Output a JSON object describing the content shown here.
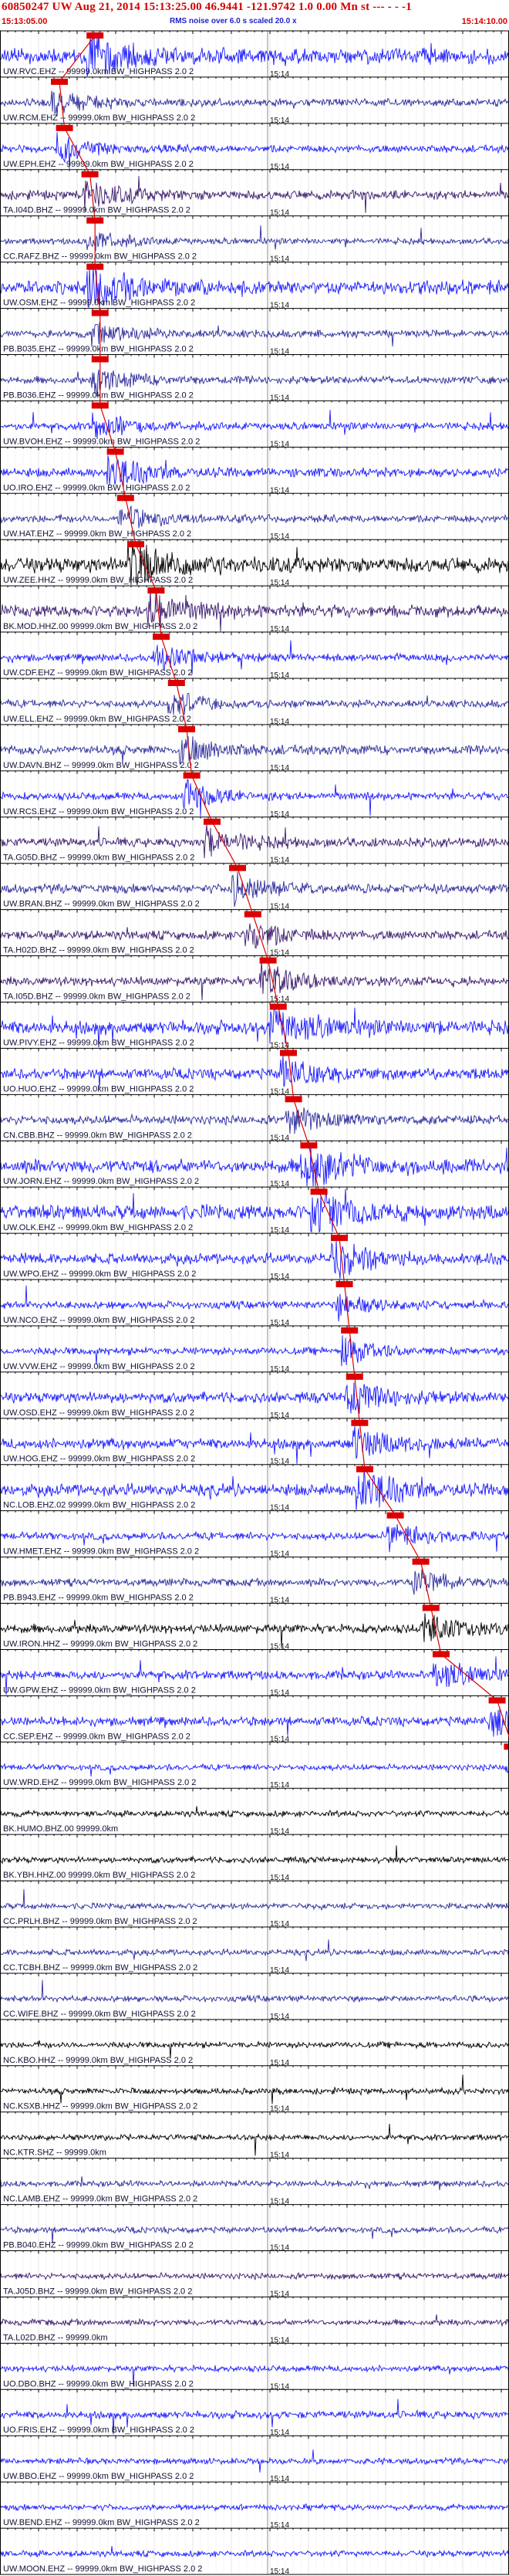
{
  "header": {
    "title": "60850247 UW Aug 21, 2014 15:13:25.00 46.9441 -121.9742 1.0 0.00 Mn st --- - - -1",
    "start_time": "15:13:05.00",
    "end_time": "15:14:10.00",
    "scale_note": "RMS noise over 6.0 s scaled 20.0 x"
  },
  "colors": {
    "trace_palette": [
      "#1a1aff",
      "#000000",
      "#2c2c9c",
      "#3b1a6e",
      "#111144"
    ],
    "pick": "#dd0000",
    "grid": "#000000"
  },
  "chart_data": {
    "type": "line",
    "title": "60850247 UW Aug 21, 2014 15:13:25.00 46.9441 -121.9742 1.0 0.00 Mn st --- - - -1",
    "x_start": "15:13:05.00",
    "x_end": "15:14:10.00",
    "time_tick_label": "15:14",
    "channels": [
      {
        "label": "UW.RVC.EHZ -- 99999.0km BW_HIGHPASS 2.0 2",
        "pick": 0.17,
        "color": "#1a1aff",
        "amp": 1.0
      },
      {
        "label": "UW.RCM.EHZ -- 99999.0km BW_HIGHPASS 2.0 2",
        "pick": 0.1,
        "color": "#2c2c9c",
        "amp": 0.5
      },
      {
        "label": "UW.EPH.EHZ -- 99999.0km BW_HIGHPASS 2.0 2",
        "pick": 0.11,
        "color": "#1a1aff",
        "amp": 0.5
      },
      {
        "label": "TA.I04D.BHZ -- 99999.0km BW_HIGHPASS 2.0 2",
        "pick": 0.16,
        "color": "#3b1a6e",
        "amp": 0.6
      },
      {
        "label": "CC.RAFZ.BHZ -- 99999.0km BW_HIGHPASS 2.0 2",
        "pick": 0.17,
        "color": "#2c2c9c",
        "amp": 0.4
      },
      {
        "label": "UW.OSM.EHZ -- 99999.0km BW_HIGHPASS 2.0 2",
        "pick": 0.17,
        "color": "#1a1aff",
        "amp": 0.9
      },
      {
        "label": "PB.B035.EHZ -- 99999.0km BW_HIGHPASS 2.0 2",
        "pick": 0.18,
        "color": "#2c2c9c",
        "amp": 0.5
      },
      {
        "label": "PB.B036.EHZ -- 99999.0km BW_HIGHPASS 2.0 2",
        "pick": 0.18,
        "color": "#2c2c9c",
        "amp": 0.5
      },
      {
        "label": "UW.BVOH.EHZ -- 99999.0km BW_HIGHPASS 2.0 2",
        "pick": 0.18,
        "color": "#1a1aff",
        "amp": 0.5
      },
      {
        "label": "UO.IRO.EHZ -- 99999.0km BW_HIGHPASS 2.0 2",
        "pick": 0.21,
        "color": "#1a1aff",
        "amp": 0.6
      },
      {
        "label": "UW.HAT.EHZ -- 99999.0km BW_HIGHPASS 2.0 2",
        "pick": 0.23,
        "color": "#2c2c9c",
        "amp": 0.5
      },
      {
        "label": "UW.ZEE.HHZ -- 99999.0km BW_HIGHPASS 2.0 2",
        "pick": 0.25,
        "color": "#000000",
        "amp": 1.0
      },
      {
        "label": "BK.MOD.HHZ.00 99999.0km BW_HIGHPASS 2.0 2",
        "pick": 0.29,
        "color": "#3b1a6e",
        "amp": 0.8
      },
      {
        "label": "UW.CDF.EHZ -- 99999.0km BW_HIGHPASS 2.0 2",
        "pick": 0.3,
        "color": "#1a1aff",
        "amp": 0.5
      },
      {
        "label": "UW.ELL.EHZ -- 99999.0km BW_HIGHPASS 2.0 2",
        "pick": 0.33,
        "color": "#2c2c9c",
        "amp": 0.5
      },
      {
        "label": "UW.DAVN.BHZ -- 99999.0km BW_HIGHPASS 2.0 2",
        "pick": 0.35,
        "color": "#2c2c9c",
        "amp": 0.6
      },
      {
        "label": "UW.RCS.EHZ -- 99999.0km BW_HIGHPASS 2.0 2",
        "pick": 0.36,
        "color": "#1a1aff",
        "amp": 0.5
      },
      {
        "label": "TA.G05D.BHZ -- 99999.0km BW_HIGHPASS 2.0 2",
        "pick": 0.4,
        "color": "#3b1a6e",
        "amp": 0.6
      },
      {
        "label": "UW.BRAN.BHZ -- 99999.0km BW_HIGHPASS 2.0 2",
        "pick": 0.45,
        "color": "#2c2c9c",
        "amp": 0.6
      },
      {
        "label": "TA.H02D.BHZ -- 99999.0km BW_HIGHPASS 2.0 2",
        "pick": 0.48,
        "color": "#3b1a6e",
        "amp": 0.6
      },
      {
        "label": "TA.I05D.BHZ -- 99999.0km BW_HIGHPASS 2.0 2",
        "pick": 0.51,
        "color": "#3b1a6e",
        "amp": 0.6
      },
      {
        "label": "UW.PIVY.EHZ -- 99999.0km BW_HIGHPASS 2.0 2",
        "pick": 0.53,
        "color": "#1a1aff",
        "amp": 0.9
      },
      {
        "label": "UO.HUO.EHZ -- 99999.0km BW_HIGHPASS 2.0 2",
        "pick": 0.55,
        "color": "#1a1aff",
        "amp": 0.7
      },
      {
        "label": "CN.CBB.BHZ -- 99999.0km BW_HIGHPASS 2.0 2",
        "pick": 0.56,
        "color": "#2c2c9c",
        "amp": 0.6
      },
      {
        "label": "UW.JORN.EHZ -- 99999.0km BW_HIGHPASS 2.0 2",
        "pick": 0.59,
        "color": "#1a1aff",
        "amp": 0.9
      },
      {
        "label": "UW.OLK.EHZ -- 99999.0km BW_HIGHPASS 2.0 2",
        "pick": 0.61,
        "color": "#1a1aff",
        "amp": 1.0
      },
      {
        "label": "UW.WPO.EHZ -- 99999.0km BW_HIGHPASS 2.0 2",
        "pick": 0.65,
        "color": "#1a1aff",
        "amp": 0.7
      },
      {
        "label": "UW.NCO.EHZ -- 99999.0km BW_HIGHPASS 2.0 2",
        "pick": 0.66,
        "color": "#1a1aff",
        "amp": 0.5
      },
      {
        "label": "UW.VVW.EHZ -- 99999.0km BW_HIGHPASS 2.0 2",
        "pick": 0.67,
        "color": "#1a1aff",
        "amp": 0.5
      },
      {
        "label": "UW.OSD.EHZ -- 99999.0km BW_HIGHPASS 2.0 2",
        "pick": 0.68,
        "color": "#1a1aff",
        "amp": 0.7
      },
      {
        "label": "UW.HOG.EHZ -- 99999.0km BW_HIGHPASS 2.0 2",
        "pick": 0.69,
        "color": "#1a1aff",
        "amp": 0.7
      },
      {
        "label": "NC.LOB.EHZ.02 99999.0km BW_HIGHPASS 2.0 2",
        "pick": 0.7,
        "color": "#1a1aff",
        "amp": 0.8
      },
      {
        "label": "UW.HMET.EHZ -- 99999.0km BW_HIGHPASS 2.0 2",
        "pick": 0.76,
        "color": "#1a1aff",
        "amp": 0.5
      },
      {
        "label": "PB.B943.EHZ -- 99999.0km BW_HIGHPASS 2.0 2",
        "pick": 0.81,
        "color": "#2c2c9c",
        "amp": 0.5
      },
      {
        "label": "UW.IRON.HHZ -- 99999.0km BW_HIGHPASS 2.0 2",
        "pick": 0.83,
        "color": "#000000",
        "amp": 0.6
      },
      {
        "label": "UW.GPW.EHZ -- 99999.0km BW_HIGHPASS 2.0 2",
        "pick": 0.85,
        "color": "#1a1aff",
        "amp": 0.6
      },
      {
        "label": "CC.SEP.EHZ -- 99999.0km BW_HIGHPASS 2.0 2",
        "pick": 0.96,
        "color": "#1a1aff",
        "amp": 0.6
      },
      {
        "label": "UW.WRD.EHZ -- 99999.0km BW_HIGHPASS 2.0 2",
        "pick": 0.99,
        "color": "#1a1aff",
        "amp": 0.4
      },
      {
        "label": "BK.HUMO.BHZ.00 99999.0km",
        "pick": null,
        "color": "#000000",
        "amp": 0.4
      },
      {
        "label": "BK.YBH.HHZ.00 99999.0km BW_HIGHPASS 2.0 2",
        "pick": null,
        "color": "#000000",
        "amp": 0.4
      },
      {
        "label": "CC.PRLH.BHZ -- 99999.0km BW_HIGHPASS 2.0 2",
        "pick": null,
        "color": "#2c2c9c",
        "amp": 0.4
      },
      {
        "label": "CC.TCBH.BHZ -- 99999.0km BW_HIGHPASS 2.0 2",
        "pick": null,
        "color": "#2c2c9c",
        "amp": 0.4
      },
      {
        "label": "CC.WIFE.BHZ -- 99999.0km BW_HIGHPASS 2.0 2",
        "pick": null,
        "color": "#2c2c9c",
        "amp": 0.4
      },
      {
        "label": "NC.KBO.HHZ -- 99999.0km BW_HIGHPASS 2.0 2",
        "pick": null,
        "color": "#000000",
        "amp": 0.4
      },
      {
        "label": "NC.KSXB.HHZ -- 99999.0km BW_HIGHPASS 2.0 2",
        "pick": null,
        "color": "#000000",
        "amp": 0.4
      },
      {
        "label": "NC.KTR.SHZ -- 99999.0km",
        "pick": null,
        "color": "#000000",
        "amp": 0.4
      },
      {
        "label": "NC.LAMB.EHZ -- 99999.0km BW_HIGHPASS 2.0 2",
        "pick": null,
        "color": "#2c2c9c",
        "amp": 0.4
      },
      {
        "label": "PB.B040.EHZ -- 99999.0km BW_HIGHPASS 2.0 2",
        "pick": null,
        "color": "#2c2c9c",
        "amp": 0.4
      },
      {
        "label": "TA.J05D.BHZ -- 99999.0km BW_HIGHPASS 2.0 2",
        "pick": null,
        "color": "#3b1a6e",
        "amp": 0.4
      },
      {
        "label": "TA.L02D.BHZ -- 99999.0km",
        "pick": null,
        "color": "#3b1a6e",
        "amp": 0.4
      },
      {
        "label": "UO.DBO.BHZ -- 99999.0km BW_HIGHPASS 2.0 2",
        "pick": null,
        "color": "#1a1aff",
        "amp": 0.4
      },
      {
        "label": "UO.FRIS.EHZ -- 99999.0km BW_HIGHPASS 2.0 2",
        "pick": null,
        "color": "#1a1aff",
        "amp": 0.5
      },
      {
        "label": "UW.BBO.EHZ -- 99999.0km BW_HIGHPASS 2.0 2",
        "pick": null,
        "color": "#1a1aff",
        "amp": 0.4
      },
      {
        "label": "UW.BEND.EHZ -- 99999.0km BW_HIGHPASS 2.0 2",
        "pick": null,
        "color": "#1a1aff",
        "amp": 0.4
      },
      {
        "label": "UW.MOON.EHZ -- 99999.0km BW_HIGHPASS 2.0 2",
        "pick": null,
        "color": "#1a1aff",
        "amp": 0.4
      }
    ]
  }
}
